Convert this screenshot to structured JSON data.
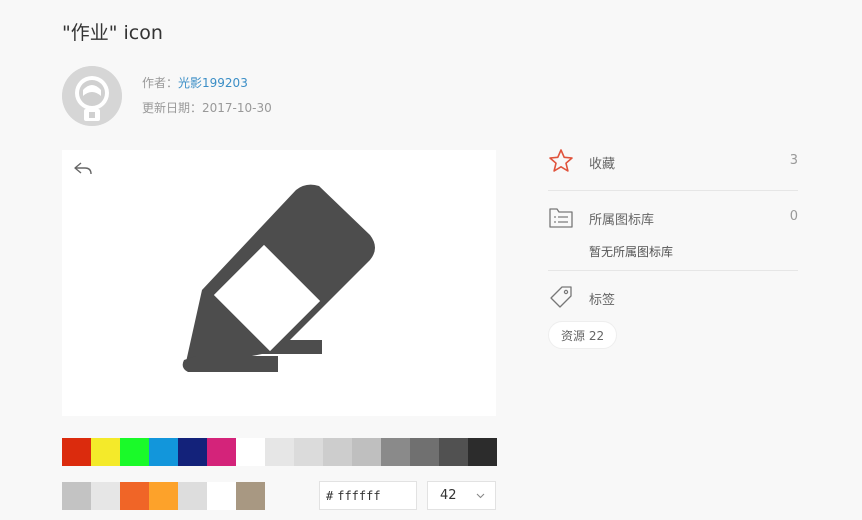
{
  "header": {
    "title": "\"作业\" icon"
  },
  "meta": {
    "author_label": "作者：",
    "author_name": "光影199203",
    "date_label": "更新日期：",
    "date_value": "2017-10-30"
  },
  "preview": {
    "icon_color": "#4d4d4d"
  },
  "palette": {
    "row1": [
      "#db2b0d",
      "#f4ea2a",
      "#1afa29",
      "#1296db",
      "#13227a",
      "#d4237a",
      "#ffffff",
      "#e6e6e6",
      "#dbdbdb",
      "#cdcdcd",
      "#bfbfbf",
      "#8a8a8a",
      "#707070",
      "#515151",
      "#2c2c2c"
    ],
    "row2": [
      "#c3c3c3",
      "#e6e6e6",
      "#f06527",
      "#fda22a",
      "#dddddd",
      "#ffffff",
      "#a89882"
    ]
  },
  "controls": {
    "hash": "#",
    "hex_value": "ffffff",
    "size_value": "42"
  },
  "sidebar": {
    "favorites": {
      "label": "收藏",
      "count": "3",
      "icon": "star-icon",
      "accent": "#e0533c"
    },
    "libraries": {
      "label": "所属图标库",
      "count": "0",
      "icon": "library-icon",
      "empty_text": "暂无所属图标库"
    },
    "tags": {
      "label": "标签",
      "icon": "tag-icon",
      "chip": "资源 22"
    }
  }
}
